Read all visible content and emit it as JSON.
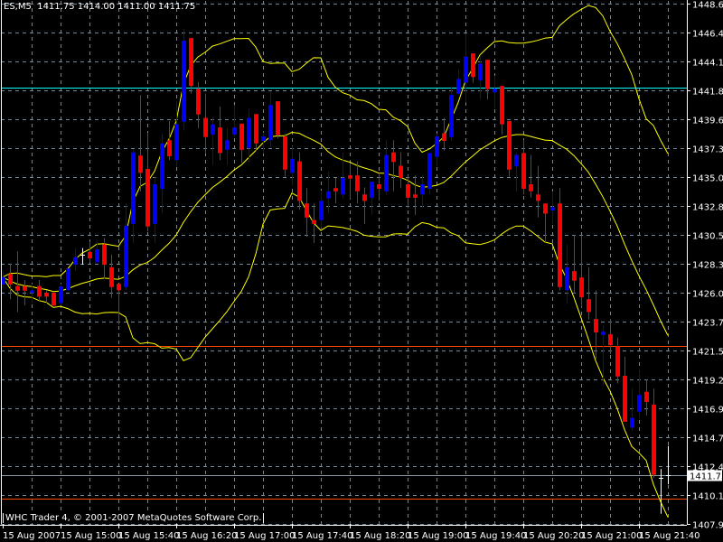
{
  "header": {
    "symbol": "ES,M5",
    "open": "1411.75",
    "high": "1414.00",
    "low": "1411.00",
    "close": "1411.75"
  },
  "copyright": "WHC Trader 4, © 2001-2007 MetaQuotes Software Corp.",
  "colors": {
    "background": "#000000",
    "bull": "#0000ff",
    "bear": "#ff0000",
    "doji": "#ffffff",
    "grid": "#778899",
    "bands": "#ffff00",
    "line_cyan": "#00ffff",
    "line_orange": "#ff4500",
    "bid_line": "#8899aa"
  },
  "chart_data": {
    "type": "candlestick",
    "symbol": "ES",
    "timeframe": "M5",
    "ylim": [
      1407.9,
      1448.65
    ],
    "price_ticks": [
      "1448.65",
      "1446.40",
      "1444.15",
      "1441.85",
      "1439.60",
      "1437.35",
      "1435.05",
      "1432.80",
      "1430.55",
      "1428.30",
      "1426.00",
      "1423.75",
      "1421.50",
      "1419.20",
      "1416.95",
      "1414.70",
      "1412.40",
      "1410.15",
      "1407.90"
    ],
    "time_labels": [
      {
        "bar": 0,
        "label": "15 Aug 2007"
      },
      {
        "bar": 8,
        "label": "15 Aug 15:00"
      },
      {
        "bar": 16,
        "label": "15 Aug 15:40"
      },
      {
        "bar": 24,
        "label": "15 Aug 16:20"
      },
      {
        "bar": 32,
        "label": "15 Aug 17:00"
      },
      {
        "bar": 40,
        "label": "15 Aug 17:40"
      },
      {
        "bar": 48,
        "label": "15 Aug 18:20"
      },
      {
        "bar": 56,
        "label": "15 Aug 19:00"
      },
      {
        "bar": 64,
        "label": "15 Aug 19:40"
      },
      {
        "bar": 72,
        "label": "15 Aug 20:20"
      },
      {
        "bar": 80,
        "label": "15 Aug 21:00"
      },
      {
        "bar": 88,
        "label": "15 Aug 21:40"
      }
    ],
    "ohlc": [
      [
        1426.65,
        1427.7,
        1426.4,
        1427.23
      ],
      [
        1427.47,
        1428.3,
        1425.5,
        1426.65
      ],
      [
        1426.53,
        1429.26,
        1424.5,
        1426.17
      ],
      [
        1426.53,
        1427.0,
        1425.0,
        1426.17
      ],
      [
        1426.0,
        1426.7,
        1425.2,
        1426.2
      ],
      [
        1426.53,
        1427.0,
        1425.3,
        1425.7
      ],
      [
        1426.0,
        1426.2,
        1425.2,
        1425.7
      ],
      [
        1426.0,
        1426.0,
        1425.0,
        1425.0
      ],
      [
        1425.2,
        1426.7,
        1425.0,
        1426.5
      ],
      [
        1426.2,
        1427.9,
        1426.2,
        1427.9
      ],
      [
        1428.2,
        1429.5,
        1427.7,
        1428.8
      ],
      [
        1428.95,
        1429.5,
        1428.2,
        1428.95
      ],
      [
        1429.2,
        1430.0,
        1428.4,
        1428.7
      ],
      [
        1428.4,
        1430.0,
        1428.4,
        1429.4
      ],
      [
        1429.8,
        1430.3,
        1427.1,
        1428.2
      ],
      [
        1428.0,
        1429.0,
        1425.6,
        1426.45
      ],
      [
        1426.7,
        1426.7,
        1423.5,
        1426.2
      ],
      [
        1426.45,
        1433.0,
        1426.2,
        1431.25
      ],
      [
        1431.4,
        1437.25,
        1429.9,
        1437.0
      ],
      [
        1436.75,
        1441.5,
        1433.95,
        1435.4
      ],
      [
        1435.7,
        1438.55,
        1430.8,
        1431.2
      ],
      [
        1431.4,
        1435.1,
        1429.9,
        1434.5
      ],
      [
        1434.15,
        1438.5,
        1432.2,
        1437.7
      ],
      [
        1437.95,
        1439.45,
        1436.4,
        1436.7
      ],
      [
        1436.4,
        1441.0,
        1435.85,
        1439.2
      ],
      [
        1439.4,
        1446.7,
        1438.7,
        1445.75
      ],
      [
        1445.95,
        1445.95,
        1441.6,
        1442.2
      ],
      [
        1441.97,
        1442.5,
        1438.9,
        1439.97
      ],
      [
        1439.7,
        1441.6,
        1436.9,
        1438.2
      ],
      [
        1438.4,
        1439.75,
        1436.0,
        1439.2
      ],
      [
        1438.95,
        1440.6,
        1436.4,
        1436.95
      ],
      [
        1437.2,
        1438.95,
        1436.0,
        1437.95
      ],
      [
        1438.4,
        1440.7,
        1438.2,
        1438.95
      ],
      [
        1439.25,
        1439.25,
        1436.2,
        1437.2
      ],
      [
        1437.35,
        1440.4,
        1436.2,
        1439.7
      ],
      [
        1440.0,
        1440.0,
        1437.15,
        1437.7
      ],
      [
        1437.9,
        1438.55,
        1436.9,
        1438.25
      ],
      [
        1437.95,
        1441.75,
        1437.4,
        1440.7
      ],
      [
        1441.0,
        1441.0,
        1438.1,
        1438.35
      ],
      [
        1438.25,
        1438.45,
        1435.1,
        1435.65
      ],
      [
        1435.4,
        1437.5,
        1434.4,
        1436.5
      ],
      [
        1436.3,
        1437.0,
        1432.5,
        1433.2
      ],
      [
        1433.0,
        1434.2,
        1430.4,
        1431.9
      ],
      [
        1431.7,
        1433.0,
        1429.9,
        1431.4
      ],
      [
        1431.7,
        1434.0,
        1431.1,
        1433.2
      ],
      [
        1433.4,
        1435.5,
        1432.2,
        1433.95
      ],
      [
        1434.2,
        1435.0,
        1433.0,
        1433.95
      ],
      [
        1433.7,
        1437.0,
        1433.4,
        1435.0
      ],
      [
        1435.2,
        1436.1,
        1433.35,
        1434.95
      ],
      [
        1435.2,
        1436.3,
        1433.0,
        1433.95
      ],
      [
        1433.7,
        1434.25,
        1431.4,
        1433.2
      ],
      [
        1433.45,
        1434.7,
        1432.1,
        1434.7
      ],
      [
        1434.5,
        1435.35,
        1433.2,
        1434.15
      ],
      [
        1433.95,
        1437.95,
        1433.7,
        1436.8
      ],
      [
        1437.0,
        1437.95,
        1433.95,
        1436.25
      ],
      [
        1435.95,
        1437.0,
        1434.2,
        1435.0
      ],
      [
        1434.5,
        1435.2,
        1432.65,
        1433.45
      ],
      [
        1433.7,
        1435.2,
        1432.1,
        1433.45
      ],
      [
        1433.7,
        1435.2,
        1432.65,
        1434.5
      ],
      [
        1434.15,
        1436.95,
        1433.7,
        1436.95
      ],
      [
        1436.65,
        1438.45,
        1435.9,
        1438.25
      ],
      [
        1438.5,
        1439.7,
        1437.15,
        1437.9
      ],
      [
        1438.2,
        1442.2,
        1437.9,
        1441.5
      ],
      [
        1441.6,
        1443.5,
        1441.5,
        1442.75
      ],
      [
        1442.45,
        1446.3,
        1440.9,
        1444.5
      ],
      [
        1444.75,
        1444.75,
        1442.45,
        1442.9
      ],
      [
        1442.65,
        1444.55,
        1441.15,
        1443.95
      ],
      [
        1444.25,
        1444.25,
        1441.15,
        1441.95
      ],
      [
        1441.7,
        1443.0,
        1440.45,
        1442.0
      ],
      [
        1442.2,
        1442.2,
        1438.4,
        1439.2
      ],
      [
        1439.45,
        1439.45,
        1435.1,
        1435.65
      ],
      [
        1435.9,
        1437.0,
        1433.95,
        1436.8
      ],
      [
        1436.95,
        1438.0,
        1433.7,
        1434.15
      ],
      [
        1434.5,
        1436.8,
        1433.45,
        1433.95
      ],
      [
        1433.7,
        1435.95,
        1431.9,
        1433.2
      ],
      [
        1433.0,
        1433.0,
        1429.95,
        1432.2
      ],
      [
        1432.45,
        1433.95,
        1431.4,
        1432.7
      ],
      [
        1433.0,
        1434.2,
        1426.2,
        1426.45
      ],
      [
        1426.2,
        1429.8,
        1425.2,
        1428.0
      ],
      [
        1427.7,
        1430.5,
        1425.95,
        1426.95
      ],
      [
        1427.2,
        1430.5,
        1424.9,
        1425.65
      ],
      [
        1425.5,
        1428.0,
        1423.9,
        1424.5
      ],
      [
        1423.95,
        1426.2,
        1420.85,
        1422.9
      ],
      [
        1422.7,
        1423.45,
        1418.7,
        1422.95
      ],
      [
        1422.75,
        1423.95,
        1421.2,
        1421.9
      ],
      [
        1421.8,
        1422.5,
        1418.9,
        1419.45
      ],
      [
        1419.5,
        1421.0,
        1415.9,
        1415.9
      ],
      [
        1415.45,
        1418.5,
        1415.2,
        1416.2
      ],
      [
        1416.7,
        1420.0,
        1416.15,
        1418.0
      ],
      [
        1418.25,
        1419.2,
        1416.4,
        1417.45
      ],
      [
        1417.25,
        1418.5,
        1411.5,
        1411.75
      ],
      [
        1411.5,
        1412.2,
        1408.7,
        1411.5
      ],
      [
        1411.75,
        1414.0,
        1411.0,
        1411.75
      ]
    ],
    "horizontal_lines": [
      {
        "price": 1442.1,
        "color": "cyan"
      },
      {
        "price": 1421.85,
        "color": "orange"
      },
      {
        "price": 1409.9,
        "color": "orange"
      }
    ],
    "bid": "1411.75"
  }
}
